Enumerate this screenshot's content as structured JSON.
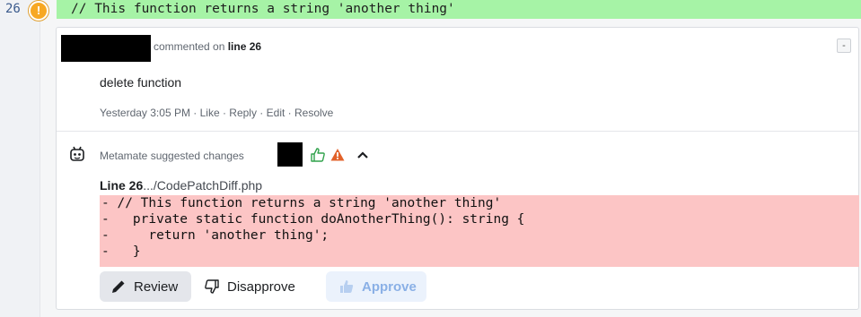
{
  "code": {
    "line_number": "26",
    "warning_glyph": "!",
    "line_text": "// This function returns a string 'another thing'"
  },
  "comment": {
    "commented_on": "commented on ",
    "line_ref": "line 26",
    "collapse_label": "-",
    "body": "delete function",
    "actions": "Yesterday 3:05 PM · Like · Reply · Edit · Resolve"
  },
  "suggestion": {
    "title": "Metamate suggested changes",
    "file_line_bold": "Line 26",
    "file_path": ".../CodePatchDiff.php",
    "diff_lines": [
      "- // This function returns a string 'another thing'",
      "-   private static function doAnotherThing(): string {",
      "-     return 'another thing';",
      "-   }"
    ],
    "buttons": {
      "review": "Review",
      "disapprove": "Disapprove",
      "approve": "Approve"
    }
  },
  "colors": {
    "added_line_bg": "#a6f3a6",
    "removed_diff_bg": "#fcc5c5",
    "warning_orange": "#f7a823",
    "approve_blue": "#8ab0e6"
  },
  "icons": [
    "warning-badge-icon",
    "robot-icon",
    "thumbs-up-outline-icon",
    "warning-triangle-icon",
    "caret-up-icon",
    "pencil-icon",
    "thumbs-down-outline-icon",
    "thumbs-up-filled-icon"
  ]
}
